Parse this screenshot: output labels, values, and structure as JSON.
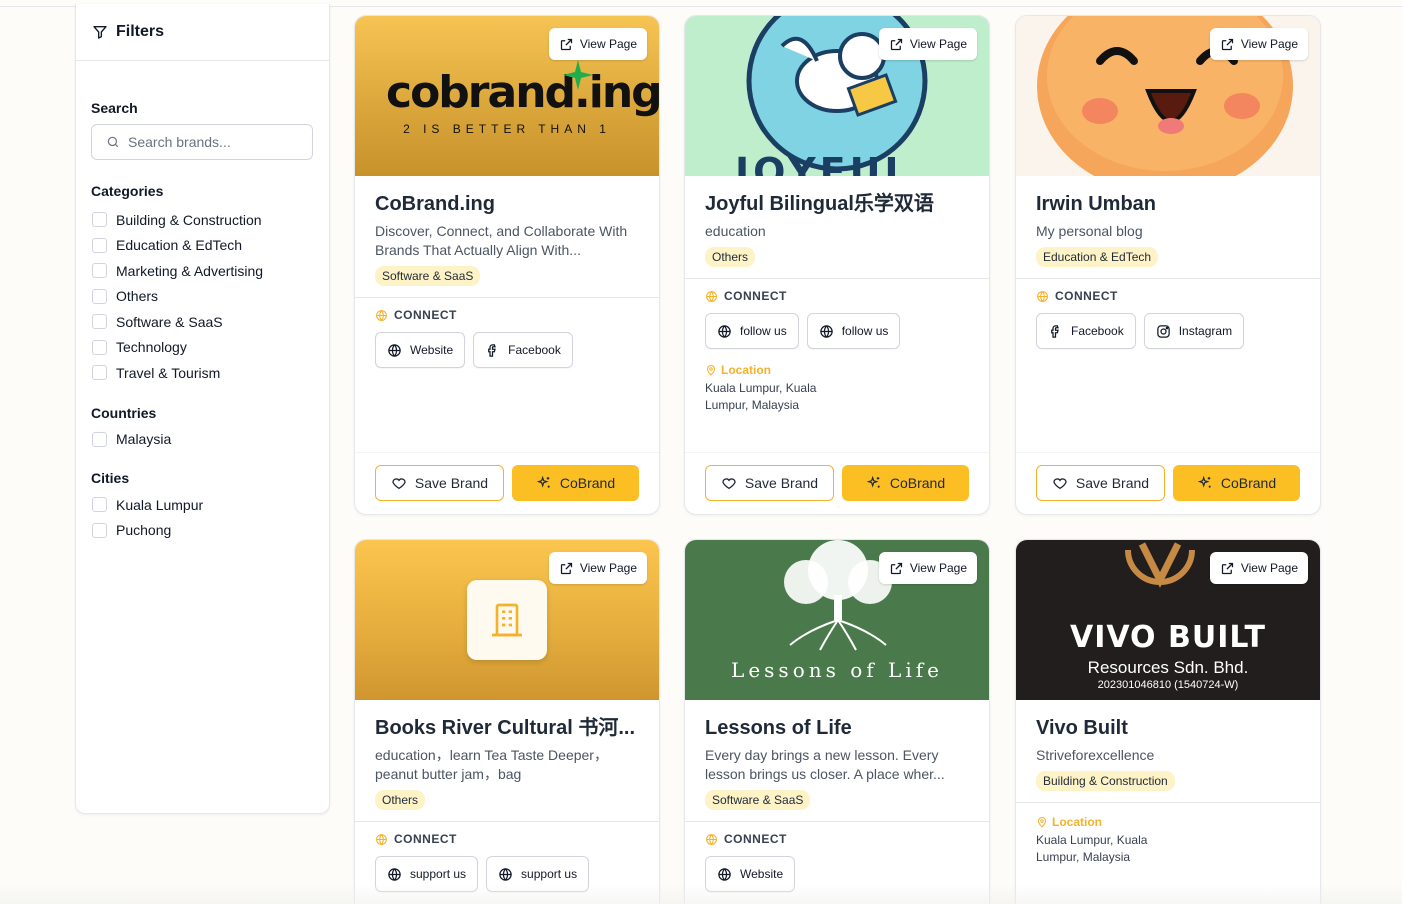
{
  "sidebar": {
    "title": "Filters",
    "search": {
      "label": "Search",
      "placeholder": "Search brands..."
    },
    "categories": {
      "title": "Categories",
      "items": [
        "Building & Construction",
        "Education & EdTech",
        "Marketing & Advertising",
        "Others",
        "Software & SaaS",
        "Technology",
        "Travel & Tourism"
      ]
    },
    "countries": {
      "title": "Countries",
      "items": [
        "Malaysia"
      ]
    },
    "cities": {
      "title": "Cities",
      "items": [
        "Kuala Lumpur",
        "Puchong"
      ]
    }
  },
  "common": {
    "view_page": "View Page",
    "connect": "CONNECT",
    "location_label": "Location",
    "save_brand": "Save Brand",
    "cobrand": "CoBrand"
  },
  "cards": [
    {
      "title": "CoBrand.ing",
      "description": "Discover, Connect, and Collaborate With Brands That Actually Align With...",
      "tag": "Software & SaaS",
      "links": [
        {
          "label": "Website",
          "icon": "globe-icon"
        },
        {
          "label": "Facebook",
          "icon": "facebook-icon"
        }
      ],
      "image": {
        "logo_text": "cobrand.ing",
        "tagline": "2 IS BETTER THAN 1"
      }
    },
    {
      "title": "Joyful Bilingual乐学双语",
      "description": "education",
      "tag": "Others",
      "links": [
        {
          "label": "follow us",
          "icon": "globe-icon"
        },
        {
          "label": "follow us",
          "icon": "globe-icon"
        }
      ],
      "location": "Kuala Lumpur, Kuala Lumpur, Malaysia",
      "image": {
        "logo_text": "JOYFUL"
      }
    },
    {
      "title": "Irwin Umban",
      "description": "My personal blog",
      "tag": "Education & EdTech",
      "links": [
        {
          "label": "Facebook",
          "icon": "facebook-icon"
        },
        {
          "label": "Instagram",
          "icon": "instagram-icon"
        }
      ]
    },
    {
      "title": "Books River Cultural 书河...",
      "description": "education，learn Tea Taste Deeper，peanut butter jam，bag",
      "tag": "Others",
      "links": [
        {
          "label": "support us",
          "icon": "globe-icon"
        },
        {
          "label": "support us",
          "icon": "globe-icon"
        }
      ]
    },
    {
      "title": "Lessons of Life",
      "description": "Every day brings a new lesson. Every lesson brings us closer. A place wher...",
      "tag": "Software & SaaS",
      "links": [
        {
          "label": "Website",
          "icon": "globe-icon"
        }
      ],
      "image": {
        "logo_text": "Lessons of Life"
      }
    },
    {
      "title": "Vivo Built",
      "description": "Striveforexcellence",
      "tag": "Building & Construction",
      "location": "Kuala Lumpur, Kuala Lumpur, Malaysia",
      "image": {
        "logo_text": "VIVO BUILT",
        "line2": "Resources Sdn. Bhd.",
        "line3": "202301046810 (1540724-W)"
      }
    }
  ],
  "colors": {
    "accent": "#fbbf24",
    "accent_border": "#f4b12b",
    "tag_bg": "#fef3c7"
  }
}
